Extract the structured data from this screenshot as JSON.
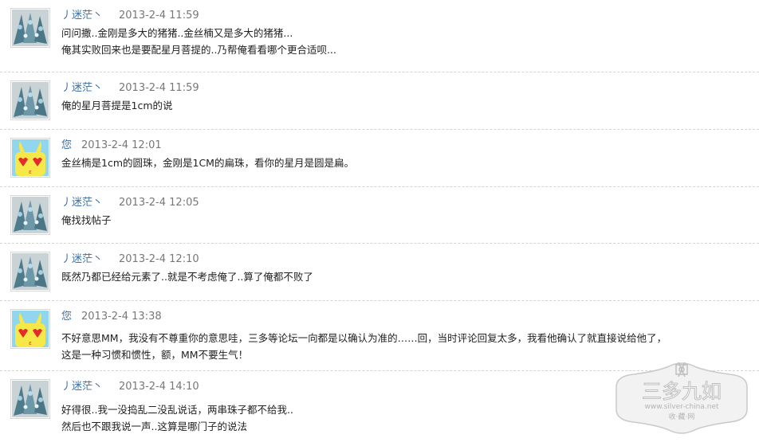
{
  "messages": [
    {
      "author": "丿迷茫丶",
      "time": "2013-2-4 11:59",
      "avatar": "beads-photo-avatar",
      "lines": [
        "问问撒..金刚是多大的猪猪..金丝楠又是多大的猪猪...",
        "俺其实败回来也是要配星月菩提的..乃帮俺看看哪个更合适呗..."
      ]
    },
    {
      "author": "丿迷茫丶",
      "time": "2013-2-4 11:59",
      "avatar": "beads-photo-avatar",
      "lines": [
        "俺的星月菩提是1cm的说"
      ]
    },
    {
      "author": "您",
      "time": "2013-2-4 12:01",
      "avatar": "cartoon-rabbit-avatar",
      "lines": [
        "金丝楠是1cm的圆珠，金刚是1CM的扁珠，看你的星月是圆是扁。"
      ]
    },
    {
      "author": "丿迷茫丶",
      "time": "2013-2-4 12:05",
      "avatar": "beads-photo-avatar",
      "lines": [
        "俺找找帖子"
      ]
    },
    {
      "author": "丿迷茫丶",
      "time": "2013-2-4 12:10",
      "avatar": "beads-photo-avatar",
      "lines": [
        "既然乃都已经给元素了..就是不考虑俺了..算了俺都不败了"
      ]
    },
    {
      "author": "您",
      "time": "2013-2-4 13:38",
      "avatar": "cartoon-rabbit-avatar",
      "lines": [
        "不好意思MM，我没有不尊重你的意思哇，三多等论坛一向都是以确认为准的……回，当时评论回复太多，我看他确认了就直接说给他了，",
        "这是一种习惯和惯性，额，MM不要生气！"
      ]
    },
    {
      "author": "丿迷茫丶",
      "time": "2013-2-4 14:10",
      "avatar": "beads-photo-avatar",
      "lines": [
        "好得很..我一没捣乱二没乱说话，两串珠子都不给我..",
        "然后也不跟我说一声..这算是哪门子的说法"
      ]
    }
  ],
  "watermark": {
    "name": "三多九如",
    "url": "www.silver-china.net",
    "tagline": "收·藏·网",
    "icon": "endless-knot-icon"
  },
  "colors": {
    "author_link": "#3a6ea5",
    "time": "#777777",
    "divider": "#d4d4d4"
  }
}
